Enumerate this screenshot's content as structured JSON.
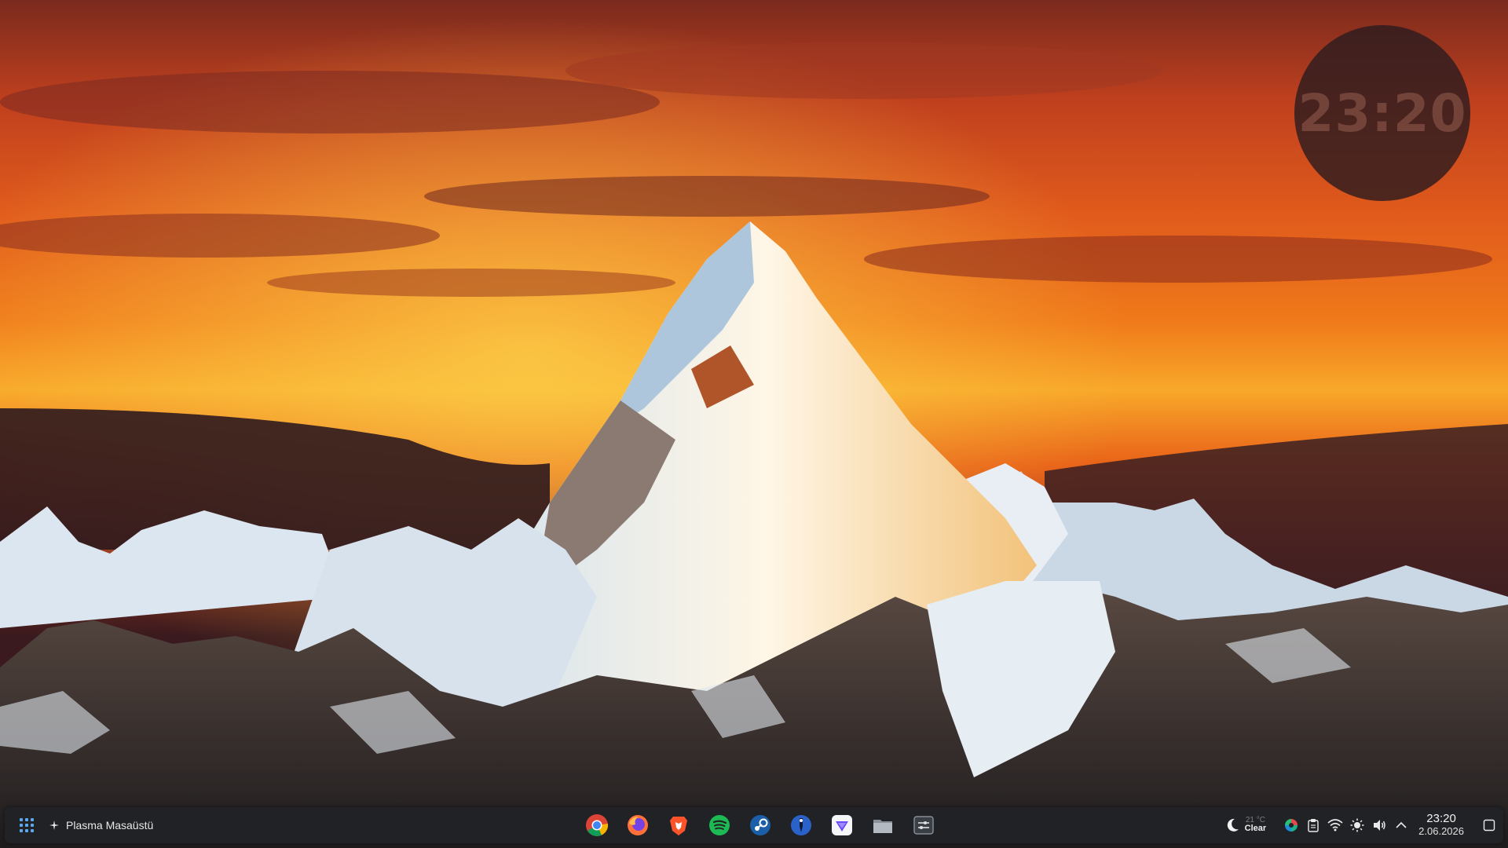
{
  "desktop": {
    "clock_widget": {
      "time": "23:20"
    }
  },
  "panel": {
    "launcher_icon": "app-grid-icon",
    "search": {
      "label": "Plasma Masaüstü",
      "icon": "sparkle-icon"
    },
    "tasks": [
      {
        "name": "chrome",
        "icon": "chrome-icon"
      },
      {
        "name": "firefox",
        "icon": "firefox-icon"
      },
      {
        "name": "brave",
        "icon": "brave-icon"
      },
      {
        "name": "spotify",
        "icon": "spotify-icon"
      },
      {
        "name": "steam",
        "icon": "steam-icon"
      },
      {
        "name": "pin-app",
        "icon": "pin-icon"
      },
      {
        "name": "proton-vpn",
        "icon": "vpn-icon"
      },
      {
        "name": "files",
        "icon": "folder-icon"
      },
      {
        "name": "settings",
        "icon": "settings-app-icon"
      }
    ],
    "weather": {
      "temp": "21 °C",
      "condition": "Clear",
      "icon": "moon-icon"
    },
    "tray": [
      {
        "name": "color-picker",
        "icon": "color-wheel-icon"
      },
      {
        "name": "clipboard",
        "icon": "clipboard-icon"
      },
      {
        "name": "network",
        "icon": "wifi-icon"
      },
      {
        "name": "brightness",
        "icon": "brightness-icon"
      },
      {
        "name": "volume",
        "icon": "volume-icon"
      },
      {
        "name": "expand-tray",
        "icon": "chevron-up-icon"
      }
    ],
    "clock": {
      "time": "23:20",
      "date": "2.06.2026"
    }
  },
  "colors": {
    "panel_bg": "#202226",
    "sky_orange": "#f07020",
    "sky_yellow": "#f8b830"
  }
}
